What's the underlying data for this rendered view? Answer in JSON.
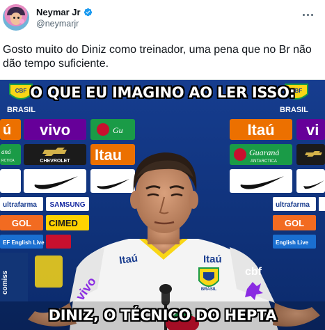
{
  "tweet": {
    "display_name": "Neymar Jr",
    "handle": "@neymarjr",
    "text": "Gosto muito do Diniz como treinador, uma pena que no Br não dão tempo suficiente."
  },
  "meme": {
    "top_caption": "O QUE EU IMAGINO AO LER ISSO:",
    "bottom_caption": "DINIZ, O TÉCNICO DO HEPTA",
    "backdrop_logos": {
      "brasil": "BRASIL",
      "vivo": "vivo",
      "itau": "Itaú",
      "chevrolet": "CHEVROLET",
      "guarana": "Guaraná",
      "antarctica": "ANTARCTICA",
      "ultrafarma": "ultrafarma",
      "samsung": "SAMSUNG",
      "gol": "GOL",
      "cimed": "CIMED",
      "english_live": "EF English Live",
      "shirt_sponsor": "Itaú",
      "shirt_badge_text": "BRASIL",
      "mic_brand": "cbf"
    },
    "watermark": "comissão"
  },
  "colors": {
    "backdrop_blue": "#0e2f78",
    "vivo_purple": "#660099",
    "itau_orange": "#ec7000",
    "brasil_yellow": "#f9d616",
    "brasil_green": "#1a9b47"
  },
  "icons": [
    "verified-badge-icon",
    "more-options-icon",
    "cbf-crest-icon"
  ]
}
